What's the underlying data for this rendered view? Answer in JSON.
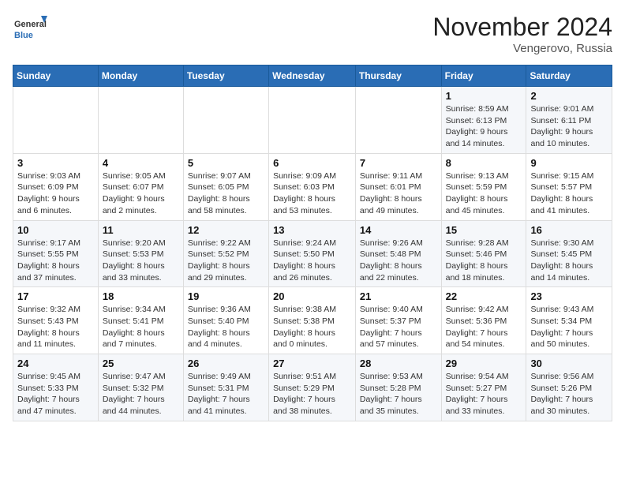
{
  "logo": {
    "line1": "General",
    "line2": "Blue"
  },
  "title": "November 2024",
  "subtitle": "Vengerovo, Russia",
  "weekdays": [
    "Sunday",
    "Monday",
    "Tuesday",
    "Wednesday",
    "Thursday",
    "Friday",
    "Saturday"
  ],
  "weeks": [
    [
      {
        "day": "",
        "info": ""
      },
      {
        "day": "",
        "info": ""
      },
      {
        "day": "",
        "info": ""
      },
      {
        "day": "",
        "info": ""
      },
      {
        "day": "",
        "info": ""
      },
      {
        "day": "1",
        "info": "Sunrise: 8:59 AM\nSunset: 6:13 PM\nDaylight: 9 hours and 14 minutes."
      },
      {
        "day": "2",
        "info": "Sunrise: 9:01 AM\nSunset: 6:11 PM\nDaylight: 9 hours and 10 minutes."
      }
    ],
    [
      {
        "day": "3",
        "info": "Sunrise: 9:03 AM\nSunset: 6:09 PM\nDaylight: 9 hours and 6 minutes."
      },
      {
        "day": "4",
        "info": "Sunrise: 9:05 AM\nSunset: 6:07 PM\nDaylight: 9 hours and 2 minutes."
      },
      {
        "day": "5",
        "info": "Sunrise: 9:07 AM\nSunset: 6:05 PM\nDaylight: 8 hours and 58 minutes."
      },
      {
        "day": "6",
        "info": "Sunrise: 9:09 AM\nSunset: 6:03 PM\nDaylight: 8 hours and 53 minutes."
      },
      {
        "day": "7",
        "info": "Sunrise: 9:11 AM\nSunset: 6:01 PM\nDaylight: 8 hours and 49 minutes."
      },
      {
        "day": "8",
        "info": "Sunrise: 9:13 AM\nSunset: 5:59 PM\nDaylight: 8 hours and 45 minutes."
      },
      {
        "day": "9",
        "info": "Sunrise: 9:15 AM\nSunset: 5:57 PM\nDaylight: 8 hours and 41 minutes."
      }
    ],
    [
      {
        "day": "10",
        "info": "Sunrise: 9:17 AM\nSunset: 5:55 PM\nDaylight: 8 hours and 37 minutes."
      },
      {
        "day": "11",
        "info": "Sunrise: 9:20 AM\nSunset: 5:53 PM\nDaylight: 8 hours and 33 minutes."
      },
      {
        "day": "12",
        "info": "Sunrise: 9:22 AM\nSunset: 5:52 PM\nDaylight: 8 hours and 29 minutes."
      },
      {
        "day": "13",
        "info": "Sunrise: 9:24 AM\nSunset: 5:50 PM\nDaylight: 8 hours and 26 minutes."
      },
      {
        "day": "14",
        "info": "Sunrise: 9:26 AM\nSunset: 5:48 PM\nDaylight: 8 hours and 22 minutes."
      },
      {
        "day": "15",
        "info": "Sunrise: 9:28 AM\nSunset: 5:46 PM\nDaylight: 8 hours and 18 minutes."
      },
      {
        "day": "16",
        "info": "Sunrise: 9:30 AM\nSunset: 5:45 PM\nDaylight: 8 hours and 14 minutes."
      }
    ],
    [
      {
        "day": "17",
        "info": "Sunrise: 9:32 AM\nSunset: 5:43 PM\nDaylight: 8 hours and 11 minutes."
      },
      {
        "day": "18",
        "info": "Sunrise: 9:34 AM\nSunset: 5:41 PM\nDaylight: 8 hours and 7 minutes."
      },
      {
        "day": "19",
        "info": "Sunrise: 9:36 AM\nSunset: 5:40 PM\nDaylight: 8 hours and 4 minutes."
      },
      {
        "day": "20",
        "info": "Sunrise: 9:38 AM\nSunset: 5:38 PM\nDaylight: 8 hours and 0 minutes."
      },
      {
        "day": "21",
        "info": "Sunrise: 9:40 AM\nSunset: 5:37 PM\nDaylight: 7 hours and 57 minutes."
      },
      {
        "day": "22",
        "info": "Sunrise: 9:42 AM\nSunset: 5:36 PM\nDaylight: 7 hours and 54 minutes."
      },
      {
        "day": "23",
        "info": "Sunrise: 9:43 AM\nSunset: 5:34 PM\nDaylight: 7 hours and 50 minutes."
      }
    ],
    [
      {
        "day": "24",
        "info": "Sunrise: 9:45 AM\nSunset: 5:33 PM\nDaylight: 7 hours and 47 minutes."
      },
      {
        "day": "25",
        "info": "Sunrise: 9:47 AM\nSunset: 5:32 PM\nDaylight: 7 hours and 44 minutes."
      },
      {
        "day": "26",
        "info": "Sunrise: 9:49 AM\nSunset: 5:31 PM\nDaylight: 7 hours and 41 minutes."
      },
      {
        "day": "27",
        "info": "Sunrise: 9:51 AM\nSunset: 5:29 PM\nDaylight: 7 hours and 38 minutes."
      },
      {
        "day": "28",
        "info": "Sunrise: 9:53 AM\nSunset: 5:28 PM\nDaylight: 7 hours and 35 minutes."
      },
      {
        "day": "29",
        "info": "Sunrise: 9:54 AM\nSunset: 5:27 PM\nDaylight: 7 hours and 33 minutes."
      },
      {
        "day": "30",
        "info": "Sunrise: 9:56 AM\nSunset: 5:26 PM\nDaylight: 7 hours and 30 minutes."
      }
    ]
  ]
}
